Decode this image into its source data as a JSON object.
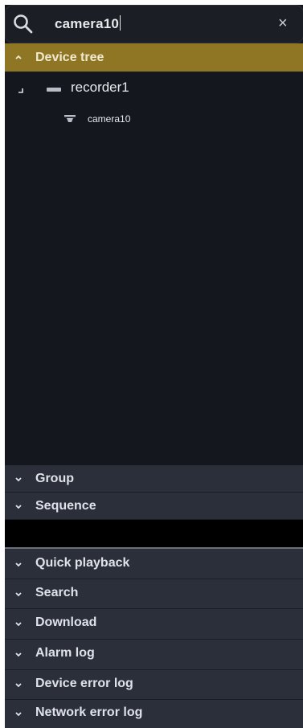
{
  "search": {
    "value": "camera10",
    "clear_symbol": "×"
  },
  "device_tree": {
    "title": "Device tree",
    "expanded": true,
    "nodes": [
      {
        "label": "recorder1",
        "icon": "recorder-icon",
        "children": [
          {
            "label": "camera10",
            "icon": "camera-icon"
          }
        ]
      }
    ]
  },
  "sections": {
    "group": "Group",
    "sequence": "Sequence",
    "quick_playback": "Quick playback",
    "search": "Search",
    "download": "Download",
    "alarm_log": "Alarm log",
    "device_error_log": "Device error log",
    "network_error_log": "Network error log"
  },
  "colors": {
    "active_header": "#8f7625",
    "header": "#2a2f3a",
    "tree_background": "#14171e"
  }
}
